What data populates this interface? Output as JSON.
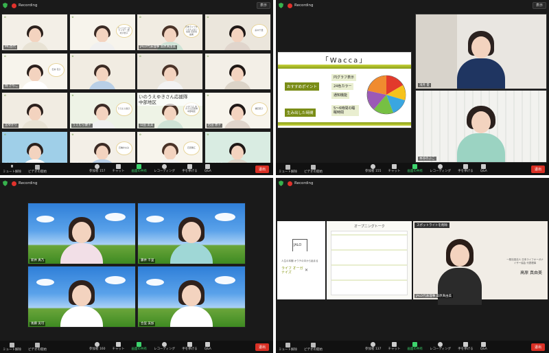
{
  "recording_label": "Recording",
  "view_label": "表示",
  "toolbar": {
    "mute": "ミュート解除",
    "video": "ビデオの開始",
    "participants": "参加者",
    "chat": "チャット",
    "share": "画面の共有",
    "record": "レコーディング",
    "raise": "手を挙げる",
    "qa": "Q&A",
    "end": "退出",
    "counts": [
      "157",
      "155",
      "160",
      "137"
    ]
  },
  "q1_tiles": [
    {
      "name": "MC西代",
      "placard": ""
    },
    {
      "name": "",
      "placard": "ライフオーガナイザー 西村沙智子"
    },
    {
      "name": "JALO代表理事 高原真由美",
      "placard": "日本ライフオーガナイザー協会 高原真由美"
    },
    {
      "name": "",
      "placard": "鈴木千里"
    },
    {
      "name": "岡 さちこ",
      "placard": "石井 花子"
    },
    {
      "name": "",
      "placard": ""
    },
    {
      "name": "",
      "placard": ""
    },
    {
      "name": "",
      "placard": ""
    },
    {
      "name": "宮ゆかり",
      "placard": ""
    },
    {
      "name": "うえむら健子",
      "placard": "うえむら健子"
    },
    {
      "name": "山田 友美",
      "placard": "いのうえ ゆきさん応援隊 中部地区"
    },
    {
      "name": "若田 恵子",
      "placard": "福田恵子"
    },
    {
      "name": "竹中由美",
      "placard": ""
    },
    {
      "name": "石橋 まなみ",
      "placard": "石橋まなみ"
    },
    {
      "name": "石田 雅江",
      "placard": "石田雅江"
    },
    {
      "name": "本谷のぶこ",
      "placard": ""
    },
    {
      "name": "藤井 恵",
      "placard": ""
    },
    {
      "name": "いのうえ ゆき",
      "placard": ""
    },
    {
      "name": "堀下 千里",
      "placard": "いのうえゆき"
    },
    {
      "name": "田中由美子",
      "placard": ""
    }
  ],
  "q1_banner": {
    "line1": "いのうえゆきさん応援隊",
    "line2": "中部地区"
  },
  "q2": {
    "slide_title": "「Wacca」",
    "rec_label": "おすすめポイント",
    "rec_items": [
      "円グラフ表示",
      "24色カラー",
      "通知機能"
    ],
    "time_label": "生み出した時間",
    "time_value": "5〜6時間の睡眠時間",
    "speakers": [
      "浅見 愛",
      "本谷のぶこ"
    ]
  },
  "q3_tiles": [
    {
      "name": "新井 真乃"
    },
    {
      "name": "藤井 千里"
    },
    {
      "name": "後藤 実可"
    },
    {
      "name": "合里 美加"
    }
  ],
  "q4": {
    "logo": "JALO",
    "tagline": "人生の本棚 オウチの中から始まる",
    "life_label": "ライフ オーガナイズ",
    "cross": "✕",
    "opening_title": "オープニングトーク",
    "spotlight_label": "スポットライトを削除",
    "speaker_org": "一般社団法人 日本ライフオーガナイザー協会 代表理事",
    "speaker_name": "高原 真由美",
    "speaker_tag": "JALO代表理事 高原真由美"
  },
  "colors": {
    "end_red": "#d93025",
    "share_green": "#3dd56d",
    "slide_olive": "#7a8d17"
  }
}
